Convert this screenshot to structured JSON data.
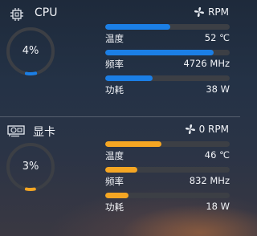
{
  "cpu": {
    "label": "CPU",
    "load": "4%",
    "load_value": 0.04,
    "fan": "RPM",
    "metrics": [
      {
        "label": "温度",
        "value": "52 ℃",
        "fill": 0.52
      },
      {
        "label": "频率",
        "value": "4726 MHz",
        "fill": 0.87
      },
      {
        "label": "功耗",
        "value": "38 W",
        "fill": 0.38
      }
    ]
  },
  "gpu": {
    "label": "显卡",
    "load": "3%",
    "load_value": 0.03,
    "fan": "0 RPM",
    "metrics": [
      {
        "label": "温度",
        "value": "46 ℃",
        "fill": 0.45
      },
      {
        "label": "频率",
        "value": "832 MHz",
        "fill": 0.26
      },
      {
        "label": "功耗",
        "value": "18 W",
        "fill": 0.19
      }
    ]
  },
  "colors": {
    "cpu_accent": "#1b7fe6",
    "gpu_accent": "#f5a623",
    "track": "#3c3f45"
  }
}
